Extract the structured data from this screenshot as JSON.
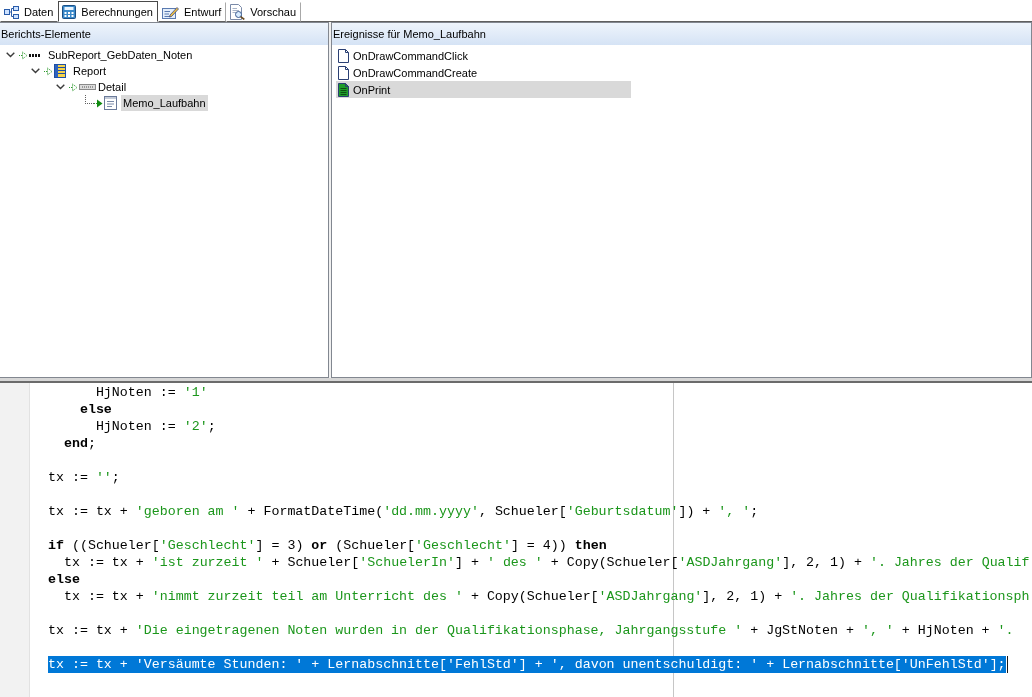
{
  "tabs": [
    {
      "label": "Daten",
      "kind": "data",
      "selected": false
    },
    {
      "label": "Berechnungen",
      "kind": "calc",
      "selected": true
    },
    {
      "label": "Entwurf",
      "kind": "design",
      "selected": false
    },
    {
      "label": "Vorschau",
      "kind": "preview",
      "selected": false
    }
  ],
  "report_tree": {
    "title": "Berichts-Elemente",
    "nodes": [
      {
        "label": "SubReport_GebDaten_Noten",
        "kind": "subreport",
        "expanded": true,
        "selected": false,
        "children": [
          {
            "label": "Report",
            "kind": "report",
            "expanded": true,
            "selected": false,
            "children": [
              {
                "label": "Detail",
                "kind": "band",
                "expanded": true,
                "selected": false,
                "children": [
                  {
                    "label": "Memo_Laufbahn",
                    "kind": "memo",
                    "selected": true
                  }
                ]
              }
            ]
          }
        ]
      }
    ]
  },
  "events": {
    "title": "Ereignisse für Memo_Laufbahn",
    "items": [
      {
        "label": "OnDrawCommandClick",
        "assigned": false,
        "selected": false
      },
      {
        "label": "OnDrawCommandCreate",
        "assigned": false,
        "selected": false
      },
      {
        "label": "OnPrint",
        "assigned": true,
        "selected": true
      }
    ]
  },
  "code_editor": {
    "lines": [
      {
        "kind": "code",
        "selected": false,
        "tokens": [
          {
            "kind": "plain",
            "text": "      HjNoten := "
          },
          {
            "kind": "string",
            "text": "'1'"
          }
        ]
      },
      {
        "kind": "code",
        "selected": false,
        "tokens": [
          {
            "kind": "keyword",
            "text": "    else"
          }
        ]
      },
      {
        "kind": "code",
        "selected": false,
        "tokens": [
          {
            "kind": "plain",
            "text": "      HjNoten := "
          },
          {
            "kind": "string",
            "text": "'2'"
          },
          {
            "kind": "plain",
            "text": ";"
          }
        ]
      },
      {
        "kind": "code",
        "selected": false,
        "tokens": [
          {
            "kind": "keyword",
            "text": "  end"
          },
          {
            "kind": "plain",
            "text": ";"
          }
        ]
      },
      {
        "kind": "blank",
        "selected": false
      },
      {
        "kind": "code",
        "selected": false,
        "tokens": [
          {
            "kind": "plain",
            "text": "tx := "
          },
          {
            "kind": "string",
            "text": "''"
          },
          {
            "kind": "plain",
            "text": ";"
          }
        ]
      },
      {
        "kind": "blank",
        "selected": false
      },
      {
        "kind": "code",
        "selected": false,
        "tokens": [
          {
            "kind": "plain",
            "text": "tx := tx + "
          },
          {
            "kind": "string",
            "text": "'geboren am '"
          },
          {
            "kind": "plain",
            "text": " + FormatDateTime("
          },
          {
            "kind": "string",
            "text": "'dd.mm.yyyy'"
          },
          {
            "kind": "plain",
            "text": ", Schueler["
          },
          {
            "kind": "string",
            "text": "'Geburtsdatum'"
          },
          {
            "kind": "plain",
            "text": "]) + "
          },
          {
            "kind": "string",
            "text": "', '"
          },
          {
            "kind": "plain",
            "text": ";"
          }
        ]
      },
      {
        "kind": "blank",
        "selected": false
      },
      {
        "kind": "code",
        "selected": false,
        "tokens": [
          {
            "kind": "keyword",
            "text": "if"
          },
          {
            "kind": "plain",
            "text": " ((Schueler["
          },
          {
            "kind": "string",
            "text": "'Geschlecht'"
          },
          {
            "kind": "plain",
            "text": "] = 3) "
          },
          {
            "kind": "keyword",
            "text": "or"
          },
          {
            "kind": "plain",
            "text": " (Schueler["
          },
          {
            "kind": "string",
            "text": "'Geschlecht'"
          },
          {
            "kind": "plain",
            "text": "] = 4)) "
          },
          {
            "kind": "keyword",
            "text": "then"
          }
        ]
      },
      {
        "kind": "code",
        "selected": false,
        "tokens": [
          {
            "kind": "plain",
            "text": "  tx := tx + "
          },
          {
            "kind": "string",
            "text": "'ist zurzeit '"
          },
          {
            "kind": "plain",
            "text": " + Schueler["
          },
          {
            "kind": "string",
            "text": "'SchuelerIn'"
          },
          {
            "kind": "plain",
            "text": "] + "
          },
          {
            "kind": "string",
            "text": "' des '"
          },
          {
            "kind": "plain",
            "text": " + Copy(Schueler["
          },
          {
            "kind": "string",
            "text": "'ASDJahrgang'"
          },
          {
            "kind": "plain",
            "text": "], 2, 1) + "
          },
          {
            "kind": "string",
            "text": "'. Jahres der Qualif"
          }
        ]
      },
      {
        "kind": "code",
        "selected": false,
        "tokens": [
          {
            "kind": "keyword",
            "text": "else"
          }
        ]
      },
      {
        "kind": "code",
        "selected": false,
        "tokens": [
          {
            "kind": "plain",
            "text": "  tx := tx + "
          },
          {
            "kind": "string",
            "text": "'nimmt zurzeit teil am Unterricht des '"
          },
          {
            "kind": "plain",
            "text": " + Copy(Schueler["
          },
          {
            "kind": "string",
            "text": "'ASDJahrgang'"
          },
          {
            "kind": "plain",
            "text": "], 2, 1) + "
          },
          {
            "kind": "string",
            "text": "'. Jahres der Qualifikationsph"
          }
        ]
      },
      {
        "kind": "blank",
        "selected": false
      },
      {
        "kind": "code",
        "selected": false,
        "tokens": [
          {
            "kind": "plain",
            "text": "tx := tx + "
          },
          {
            "kind": "string",
            "text": "'Die eingetragenen Noten wurden in der Qualifikationsphase, Jahrgangsstufe '"
          },
          {
            "kind": "plain",
            "text": " + JgStNoten + "
          },
          {
            "kind": "string",
            "text": "', '"
          },
          {
            "kind": "plain",
            "text": " + HjNoten + "
          },
          {
            "kind": "string",
            "text": "'."
          }
        ]
      },
      {
        "kind": "blank",
        "selected": false
      },
      {
        "kind": "code",
        "selected": true,
        "tokens": [
          {
            "kind": "plain",
            "text": "tx := tx + "
          },
          {
            "kind": "string",
            "text": "'Versäumte Stunden: '"
          },
          {
            "kind": "plain",
            "text": " + Lernabschnitte["
          },
          {
            "kind": "string",
            "text": "'FehlStd'"
          },
          {
            "kind": "plain",
            "text": "] + "
          },
          {
            "kind": "string",
            "text": "', davon unentschuldigt: '"
          },
          {
            "kind": "plain",
            "text": " + Lernabschnitte["
          },
          {
            "kind": "string",
            "text": "'UnFehlStd'"
          },
          {
            "kind": "plain",
            "text": "];"
          }
        ]
      },
      {
        "kind": "blank",
        "selected": false
      }
    ]
  }
}
